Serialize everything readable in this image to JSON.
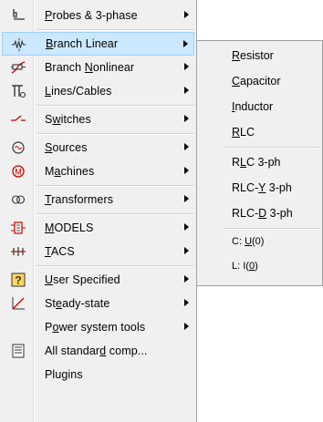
{
  "menu": {
    "items": [
      {
        "label": "Probes & 3-phase",
        "mnemonic": "P",
        "icon": "probe-icon",
        "arrow": true
      },
      {
        "label": "Branch Linear",
        "mnemonic": "B",
        "icon": "branch-linear-icon",
        "arrow": true,
        "highlighted": true
      },
      {
        "label": "Branch Nonlinear",
        "mnemonic": "N",
        "icon": "branch-nonlinear-icon",
        "arrow": true
      },
      {
        "label": "Lines/Cables",
        "mnemonic": "L",
        "icon": "lines-cables-icon",
        "arrow": true
      },
      {
        "label": "Switches",
        "mnemonic": "w",
        "icon": "switch-icon",
        "arrow": true
      },
      {
        "label": "Sources",
        "mnemonic": "S",
        "icon": "source-icon",
        "arrow": true
      },
      {
        "label": "Machines",
        "mnemonic": "a",
        "icon": "machine-icon",
        "arrow": true
      },
      {
        "label": "Transformers",
        "mnemonic": "T",
        "icon": "transformer-icon",
        "arrow": true
      },
      {
        "label": "MODELS",
        "mnemonic": "M",
        "icon": "models-icon",
        "arrow": true
      },
      {
        "label": "TACS",
        "mnemonic": "T",
        "icon": "tacs-icon",
        "arrow": true
      },
      {
        "label": "User Specified",
        "mnemonic": "U",
        "icon": "user-specified-icon",
        "arrow": true
      },
      {
        "label": "Steady-state",
        "mnemonic": "e",
        "icon": "steady-state-icon",
        "arrow": true
      },
      {
        "label": "Power system tools",
        "mnemonic": "o",
        "icon": "",
        "arrow": true
      },
      {
        "label": "All standard comp...",
        "mnemonic": "d",
        "icon": "all-components-icon",
        "arrow": false
      },
      {
        "label": "Plugins",
        "mnemonic": "",
        "icon": "",
        "arrow": false
      }
    ]
  },
  "submenu": {
    "items": [
      {
        "label": "Resistor",
        "mnemonic": "R"
      },
      {
        "label": "Capacitor",
        "mnemonic": "C"
      },
      {
        "label": "Inductor",
        "mnemonic": "I"
      },
      {
        "label": "RLC",
        "mnemonic": "R"
      },
      {
        "label": "RLC 3-ph",
        "mnemonic": "L"
      },
      {
        "label": "RLC-Y 3-ph",
        "mnemonic": "Y"
      },
      {
        "label": "RLC-D 3-ph",
        "mnemonic": "D"
      },
      {
        "label": "C: U(0)",
        "mnemonic": "U"
      },
      {
        "label": "L: I(0)",
        "mnemonic": "0"
      }
    ]
  },
  "colors": {
    "menu_bg": "#f0f0f0",
    "highlight_bg": "#cce8ff",
    "highlight_border": "#99d1ff"
  }
}
